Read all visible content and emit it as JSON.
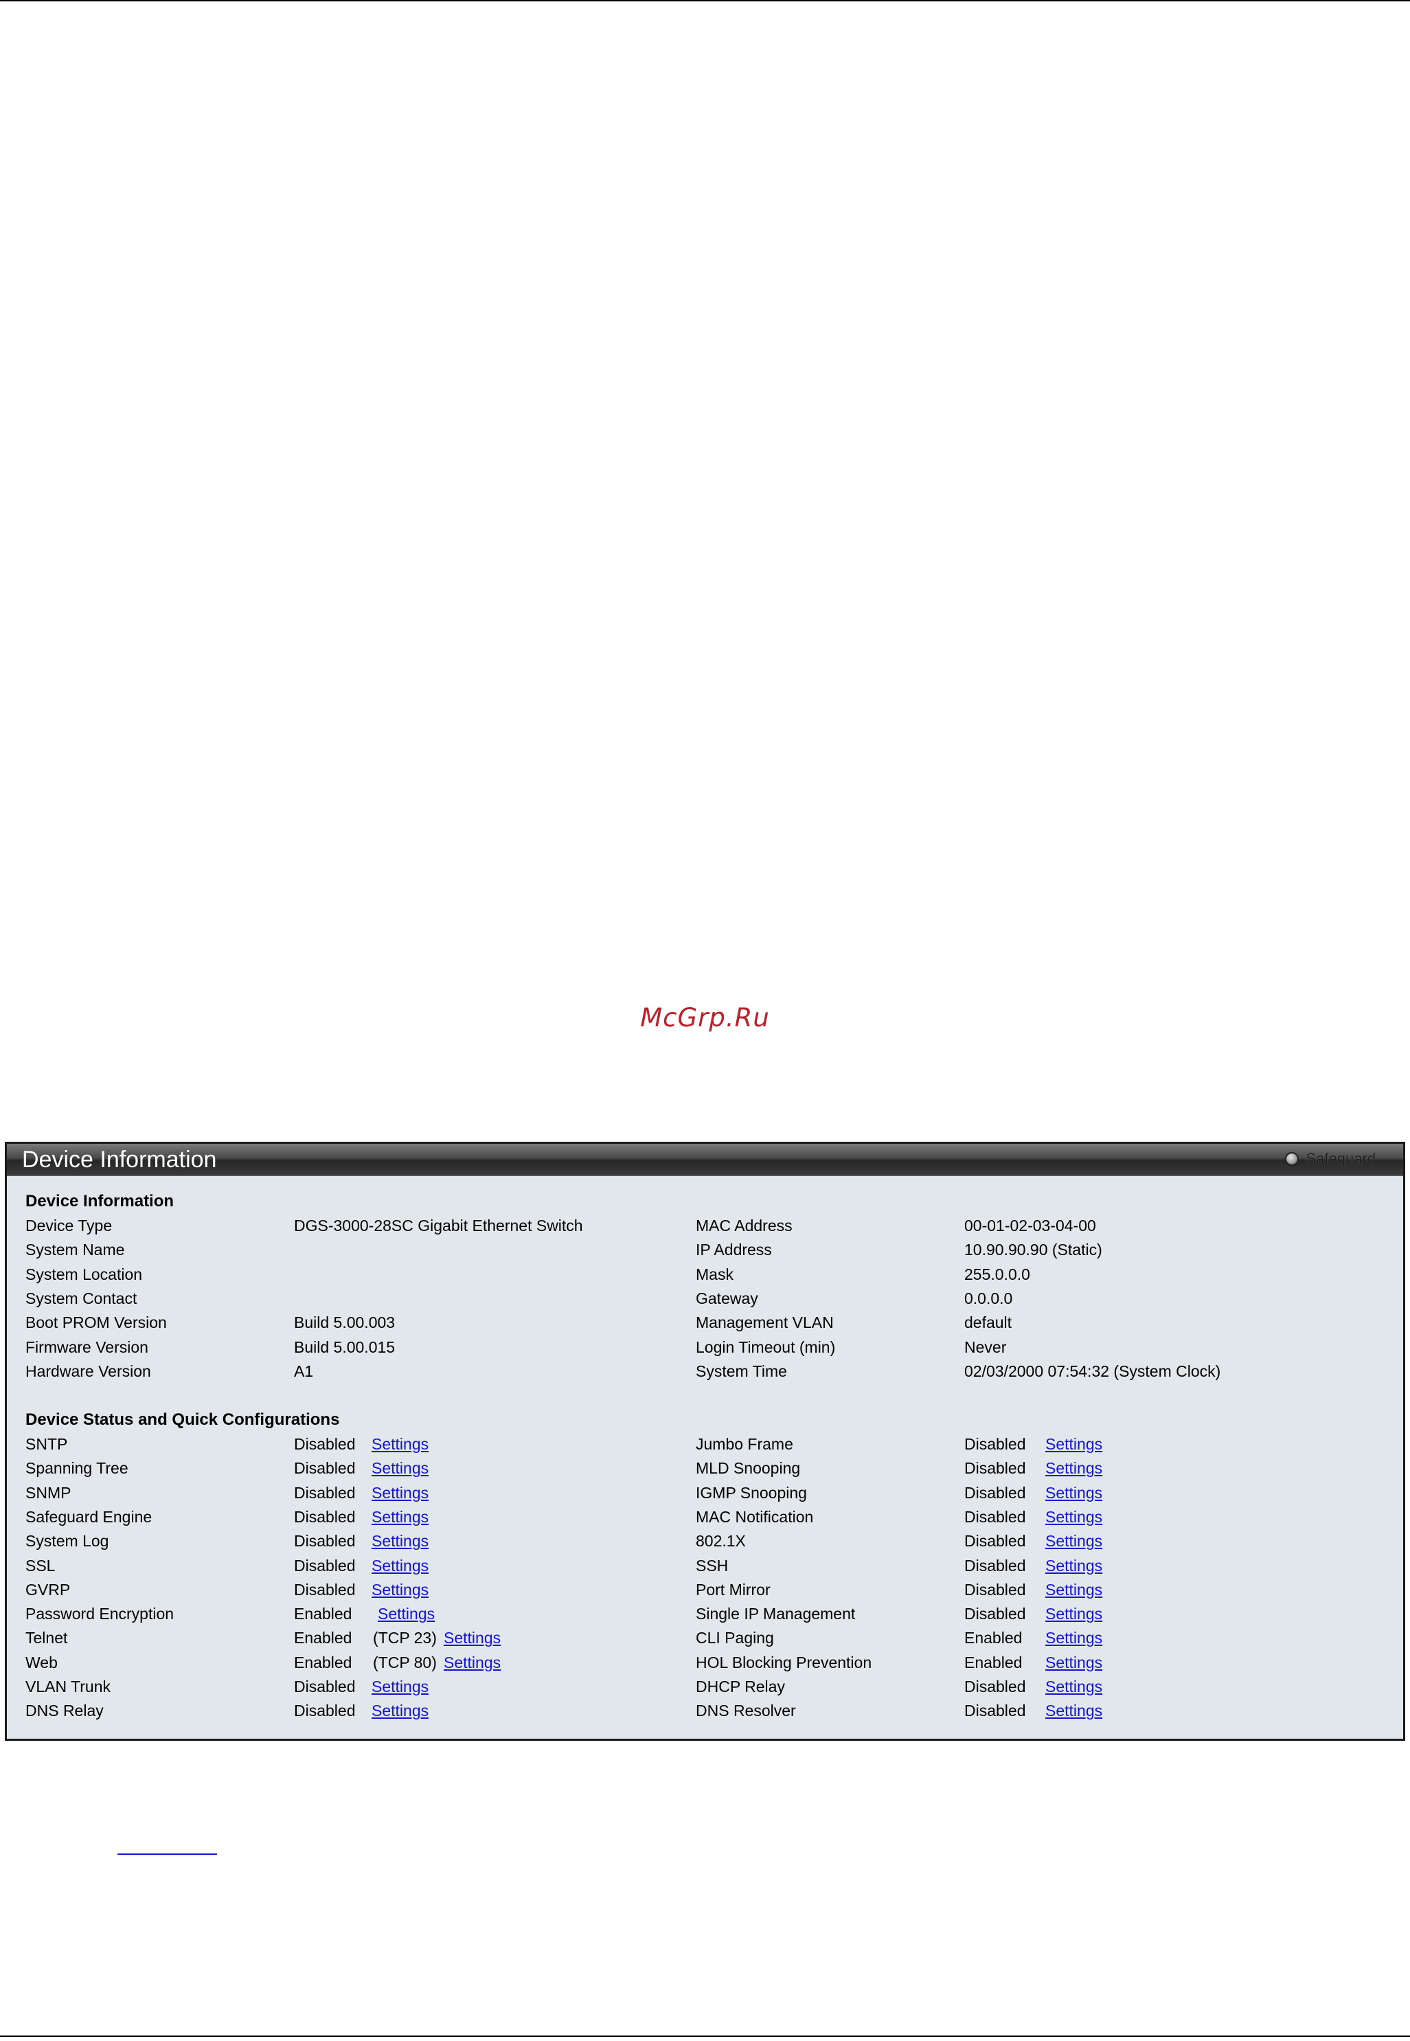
{
  "watermark": "McGrp.Ru",
  "panel": {
    "title": "Device Information",
    "safeguard_label": "Safeguard"
  },
  "device_info": {
    "section_title": "Device Information",
    "left": [
      {
        "label": "Device Type",
        "value": "DGS-3000-28SC Gigabit Ethernet Switch"
      },
      {
        "label": "System Name",
        "value": ""
      },
      {
        "label": "System Location",
        "value": ""
      },
      {
        "label": "System Contact",
        "value": ""
      },
      {
        "label": "Boot PROM Version",
        "value": "Build 5.00.003"
      },
      {
        "label": "Firmware Version",
        "value": "Build 5.00.015"
      },
      {
        "label": "Hardware Version",
        "value": "A1"
      }
    ],
    "right": [
      {
        "label": "MAC Address",
        "value": "00-01-02-03-04-00"
      },
      {
        "label": "IP Address",
        "value": "10.90.90.90 (Static)"
      },
      {
        "label": "Mask",
        "value": "255.0.0.0"
      },
      {
        "label": "Gateway",
        "value": "0.0.0.0"
      },
      {
        "label": "Management VLAN",
        "value": "default"
      },
      {
        "label": "Login Timeout (min)",
        "value": "Never"
      },
      {
        "label": "System Time",
        "value": "02/03/2000 07:54:32 (System Clock)"
      }
    ]
  },
  "status": {
    "section_title": "Device Status and Quick Configurations",
    "link_label": "Settings",
    "left": [
      {
        "label": "SNTP",
        "state": "Disabled",
        "extra": ""
      },
      {
        "label": "Spanning Tree",
        "state": "Disabled",
        "extra": ""
      },
      {
        "label": "SNMP",
        "state": "Disabled",
        "extra": ""
      },
      {
        "label": "Safeguard Engine",
        "state": "Disabled",
        "extra": ""
      },
      {
        "label": "System Log",
        "state": "Disabled",
        "extra": ""
      },
      {
        "label": "SSL",
        "state": "Disabled",
        "extra": ""
      },
      {
        "label": "GVRP",
        "state": "Disabled",
        "extra": ""
      },
      {
        "label": "Password Encryption",
        "state": "Enabled",
        "extra": ""
      },
      {
        "label": "Telnet",
        "state": "Enabled",
        "extra": "(TCP 23)"
      },
      {
        "label": "Web",
        "state": "Enabled",
        "extra": "(TCP 80)"
      },
      {
        "label": "VLAN Trunk",
        "state": "Disabled",
        "extra": ""
      },
      {
        "label": "DNS Relay",
        "state": "Disabled",
        "extra": ""
      }
    ],
    "right": [
      {
        "label": "Jumbo Frame",
        "state": "Disabled"
      },
      {
        "label": "MLD Snooping",
        "state": "Disabled"
      },
      {
        "label": "IGMP Snooping",
        "state": "Disabled"
      },
      {
        "label": "MAC Notification",
        "state": "Disabled"
      },
      {
        "label": "802.1X",
        "state": "Disabled"
      },
      {
        "label": "SSH",
        "state": "Disabled"
      },
      {
        "label": "Port Mirror",
        "state": "Disabled"
      },
      {
        "label": "Single IP Management",
        "state": "Disabled"
      },
      {
        "label": "CLI Paging",
        "state": "Enabled"
      },
      {
        "label": "HOL Blocking Prevention",
        "state": "Enabled"
      },
      {
        "label": "DHCP Relay",
        "state": "Disabled"
      },
      {
        "label": "DNS Resolver",
        "state": "Disabled"
      }
    ]
  }
}
